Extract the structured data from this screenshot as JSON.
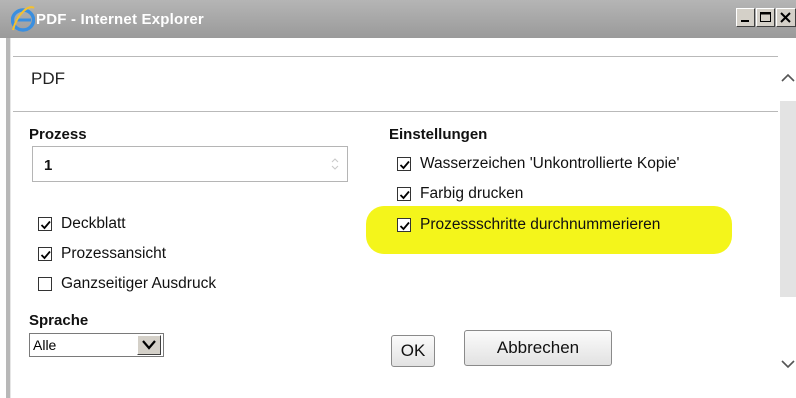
{
  "window": {
    "title": "PDF - Internet Explorer",
    "controls": [
      "minimize",
      "maximize",
      "close"
    ]
  },
  "page": {
    "title": "PDF"
  },
  "prozess": {
    "label": "Prozess",
    "value": "1"
  },
  "left_options": [
    {
      "label": "Deckblatt",
      "checked": true
    },
    {
      "label": "Prozessansicht",
      "checked": true
    },
    {
      "label": "Ganzseitiger Ausdruck",
      "checked": false
    }
  ],
  "sprache": {
    "label": "Sprache",
    "selected": "Alle"
  },
  "einstellungen": {
    "label": "Einstellungen",
    "options": [
      {
        "label": "Wasserzeichen 'Unkontrollierte Kopie'",
        "checked": true
      },
      {
        "label": "Farbig drucken",
        "checked": true
      },
      {
        "label": "Prozessschritte durchnummerieren",
        "checked": true,
        "highlighted": true
      }
    ]
  },
  "buttons": {
    "ok": "OK",
    "cancel": "Abbrechen"
  },
  "colors": {
    "highlight": "#f4f51b",
    "titlebar": "#a8a8a8"
  }
}
